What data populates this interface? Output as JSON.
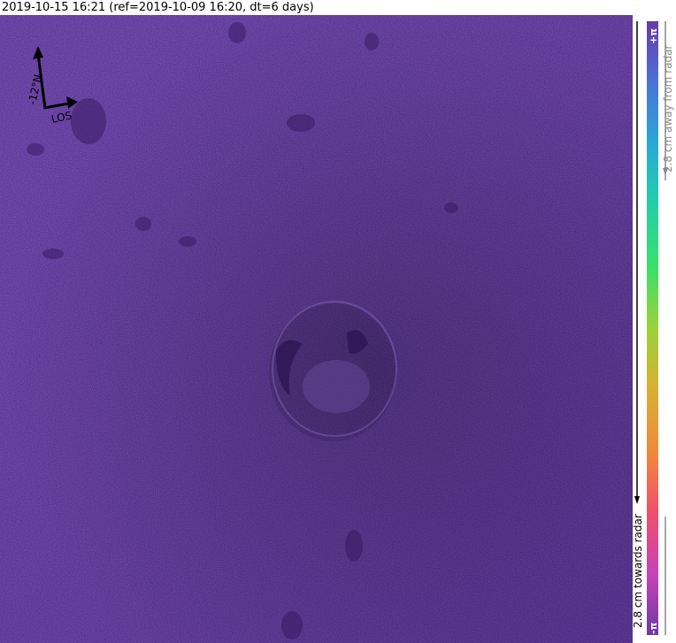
{
  "header": {
    "title": "2019-10-15 16:21 (ref=2019-10-09 16:20, dt=6 days)"
  },
  "compass": {
    "north_label": "-12°N",
    "los_label": "LOS",
    "heading_deg": -12
  },
  "colorbar": {
    "top_label": "+π",
    "bottom_label": "-π",
    "away_label": "2.8 cm away from radar",
    "towards_label": "2.8 cm towards radar",
    "colors": [
      "#6a3aa8",
      "#4a72d8",
      "#2aa8d8",
      "#22d0a8",
      "#3ae06a",
      "#9ad23a",
      "#d8b032",
      "#f08a3c",
      "#f0506a",
      "#c842b8",
      "#6a3aa8"
    ]
  },
  "map": {
    "base_color": "#6b3fb0"
  }
}
